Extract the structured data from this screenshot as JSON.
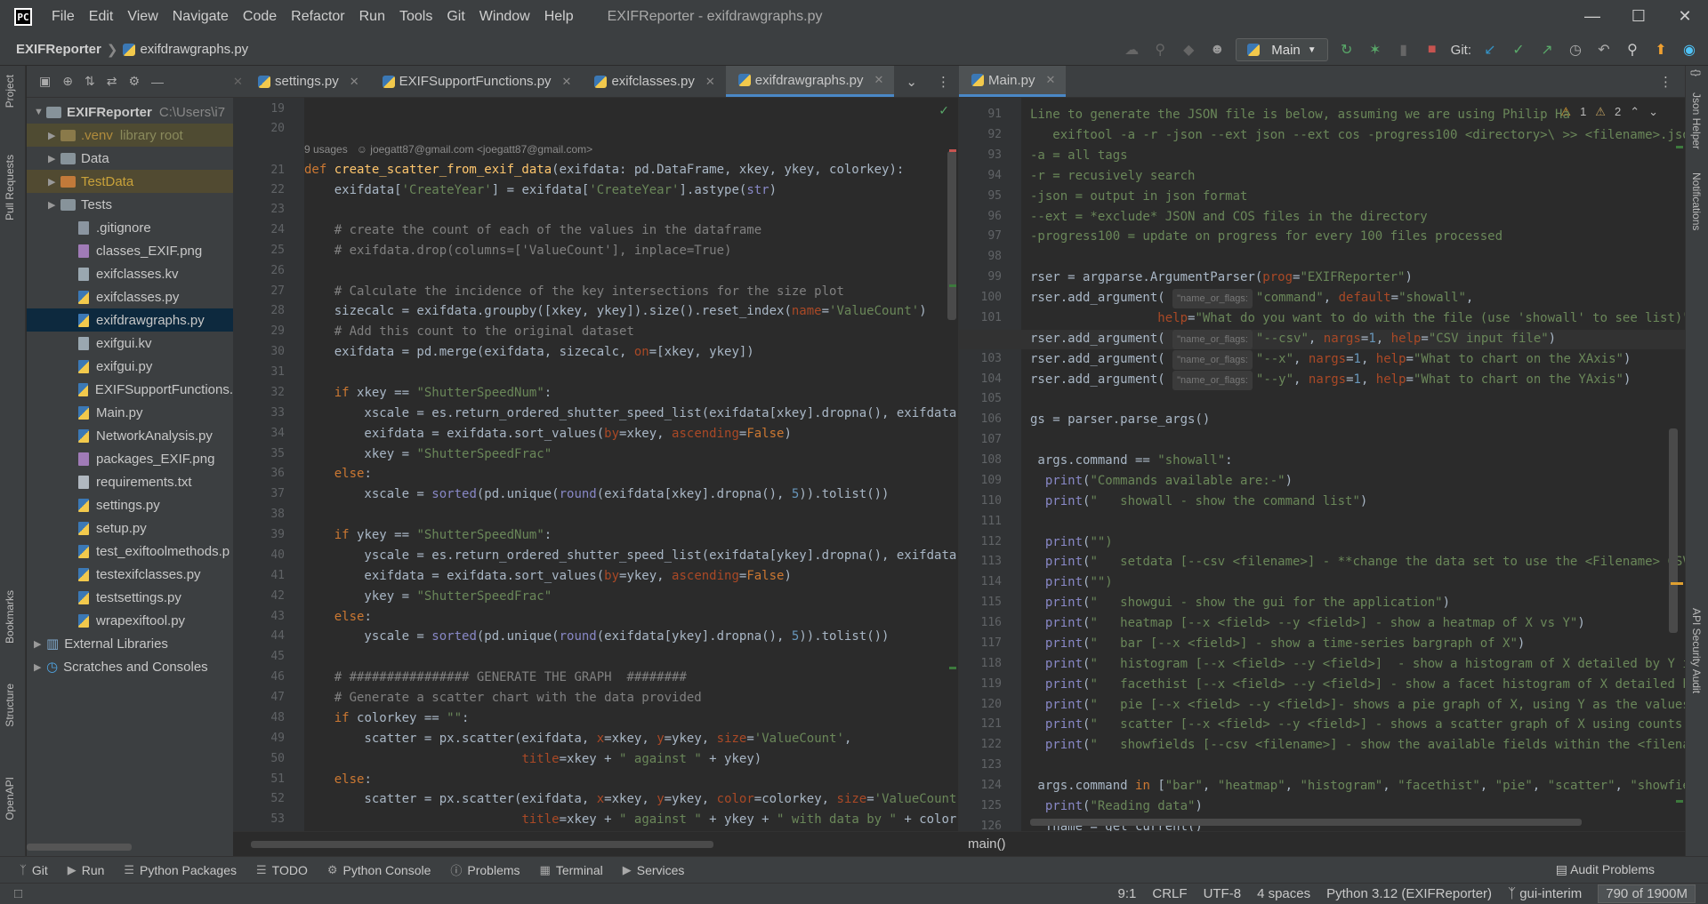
{
  "app": {
    "logo": "PC",
    "menu": [
      "File",
      "Edit",
      "View",
      "Navigate",
      "Code",
      "Refactor",
      "Run",
      "Tools",
      "Git",
      "Window",
      "Help"
    ],
    "window_title": "EXIFReporter - exifdrawgraphs.py"
  },
  "nav": {
    "project": "EXIFReporter",
    "file": "exifdrawgraphs.py",
    "run_config": "Main",
    "git_label": "Git:"
  },
  "left_stripe": [
    "Project",
    "Pull Requests",
    "Bookmarks",
    "Structure",
    "OpenAPI"
  ],
  "right_stripe": [
    "Json Helper",
    "Notifications",
    "API Security Audit"
  ],
  "project_tree": {
    "root": {
      "label": "EXIFReporter",
      "path": "C:\\Users\\i7"
    },
    "items": [
      {
        "label": ".venv",
        "suffix": "library root",
        "kind": "folder",
        "expandable": true
      },
      {
        "label": "Data",
        "kind": "folder",
        "expandable": true
      },
      {
        "label": "TestData",
        "kind": "folder",
        "expandable": true
      },
      {
        "label": "Tests",
        "kind": "folder",
        "expandable": true
      },
      {
        "label": ".gitignore",
        "kind": "file"
      },
      {
        "label": "classes_EXIF.png",
        "kind": "png"
      },
      {
        "label": "exifclasses.kv",
        "kind": "kv"
      },
      {
        "label": "exifclasses.py",
        "kind": "py"
      },
      {
        "label": "exifdrawgraphs.py",
        "kind": "py",
        "selected": true
      },
      {
        "label": "exifgui.kv",
        "kind": "kv"
      },
      {
        "label": "exifgui.py",
        "kind": "py"
      },
      {
        "label": "EXIFSupportFunctions.",
        "kind": "py"
      },
      {
        "label": "Main.py",
        "kind": "py"
      },
      {
        "label": "NetworkAnalysis.py",
        "kind": "py"
      },
      {
        "label": "packages_EXIF.png",
        "kind": "png"
      },
      {
        "label": "requirements.txt",
        "kind": "txt"
      },
      {
        "label": "settings.py",
        "kind": "py"
      },
      {
        "label": "setup.py",
        "kind": "py"
      },
      {
        "label": "test_exiftoolmethods.p",
        "kind": "py"
      },
      {
        "label": "testexifclasses.py",
        "kind": "py"
      },
      {
        "label": "testsettings.py",
        "kind": "py"
      },
      {
        "label": "wrapexiftool.py",
        "kind": "py"
      }
    ],
    "external": "External Libraries",
    "scratches": "Scratches and Consoles"
  },
  "tabs_left": [
    "settings.py",
    "EXIFSupportFunctions.py",
    "exifclasses.py",
    "exifdrawgraphs.py"
  ],
  "tabs_right": [
    "Main.py"
  ],
  "left_editor": {
    "usages": "9 usages",
    "author": "joegatt87@gmail.com <joegatt87@gmail.com>"
  },
  "right_editor": {
    "warnings": "1",
    "weak": "2",
    "breadcrumb": "main()"
  },
  "bottom_tools": [
    "Git",
    "Run",
    "Python Packages",
    "TODO",
    "Python Console",
    "Problems",
    "Terminal",
    "Services"
  ],
  "audit": "Audit Problems",
  "status": {
    "position": "9:1",
    "line_sep": "CRLF",
    "encoding": "UTF-8",
    "indent": "4 spaces",
    "interpreter": "Python 3.12 (EXIFReporter)",
    "branch": "gui-interim",
    "memory": "790 of 1900M"
  }
}
